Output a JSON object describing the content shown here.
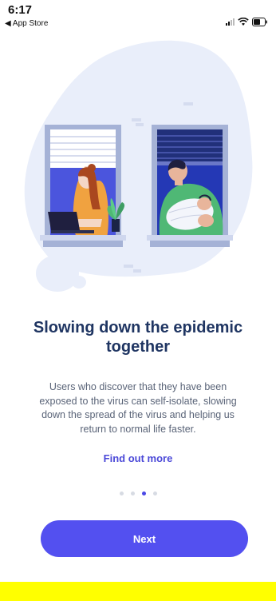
{
  "status_bar": {
    "time": "6:17",
    "back_label": "◀ App Store"
  },
  "onboarding": {
    "headline": "Slowing down the epidemic together",
    "body": "Users who discover that they have been exposed to the virus can self-isolate, slowing down the spread of the virus and helping us return to normal life faster.",
    "link_label": "Find out more",
    "page_indicator": {
      "total": 4,
      "current": 3
    },
    "next_label": "Next"
  },
  "colors": {
    "headline": "#1f3562",
    "accent": "#5350f0",
    "blob": "#e9eefa",
    "footer_bar": "#ffff00"
  },
  "icons": [
    "signal-icon",
    "wifi-icon",
    "battery-icon"
  ]
}
